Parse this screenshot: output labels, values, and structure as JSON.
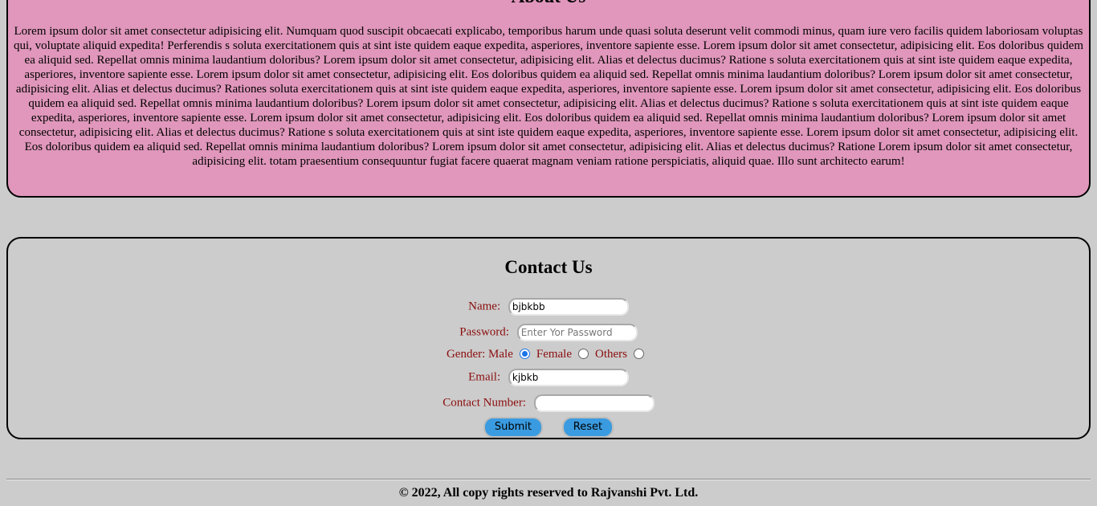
{
  "about": {
    "title": "About Us",
    "text": "Lorem ipsum dolor sit amet consectetur adipisicing elit. Numquam quod suscipit obcaecati explicabo, temporibus harum unde quasi soluta deserunt velit commodi minus, quam iure vero facilis quidem laboriosam voluptas qui, voluptate aliquid expedita! Perferendis s soluta exercitationem quis at sint iste quidem eaque expedita, asperiores, inventore sapiente esse. Lorem ipsum dolor sit amet consectetur, adipisicing elit. Eos doloribus quidem ea aliquid sed. Repellat omnis minima laudantium doloribus? Lorem ipsum dolor sit amet consectetur, adipisicing elit. Alias et delectus ducimus? Ratione s soluta exercitationem quis at sint iste quidem eaque expedita, asperiores, inventore sapiente esse. Lorem ipsum dolor sit amet consectetur, adipisicing elit. Eos doloribus quidem ea aliquid sed. Repellat omnis minima laudantium doloribus? Lorem ipsum dolor sit amet consectetur, adipisicing elit. Alias et delectus ducimus? Rationes soluta exercitationem quis at sint iste quidem eaque expedita, asperiores, inventore sapiente esse. Lorem ipsum dolor sit amet consectetur, adipisicing elit. Eos doloribus quidem ea aliquid sed. Repellat omnis minima laudantium doloribus? Lorem ipsum dolor sit amet consectetur, adipisicing elit. Alias et delectus ducimus? Ratione s soluta exercitationem quis at sint iste quidem eaque expedita, asperiores, inventore sapiente esse. Lorem ipsum dolor sit amet consectetur, adipisicing elit. Eos doloribus quidem ea aliquid sed. Repellat omnis minima laudantium doloribus? Lorem ipsum dolor sit amet consectetur, adipisicing elit. Alias et delectus ducimus? Ratione s soluta exercitationem quis at sint iste quidem eaque expedita, asperiores, inventore sapiente esse. Lorem ipsum dolor sit amet consectetur, adipisicing elit. Eos doloribus quidem ea aliquid sed. Repellat omnis minima laudantium doloribus? Lorem ipsum dolor sit amet consectetur, adipisicing elit. Alias et delectus ducimus? Ratione Lorem ipsum dolor sit amet consectetur, adipisicing elit. totam praesentium consequuntur fugiat facere quaerat magnam veniam ratione perspiciatis, aliquid quae. Illo sunt architecto earum!"
  },
  "contact": {
    "title": "Contact Us",
    "name_label": "Name:",
    "name_value": "bjbkbb",
    "password_label": "Password:",
    "password_placeholder": "Enter Yor Password",
    "gender_label": "Gender:",
    "gender_options": [
      "Male",
      "Female",
      "Others"
    ],
    "gender_selected": "Male",
    "email_label": "Email:",
    "email_value": "kjbkb",
    "phone_label": "Contact Number:",
    "phone_value": "",
    "submit_label": "Submit",
    "reset_label": "Reset"
  },
  "footer": {
    "text": "© 2022, All copy rights reserved to Rajvanshi Pvt. Ltd."
  },
  "colors": {
    "page_background": "#cccccc",
    "about_background": "#e097bb",
    "label_color": "#8b0d0d",
    "button_color": "#3a9be0",
    "radio_checked": "#1a73e8"
  }
}
